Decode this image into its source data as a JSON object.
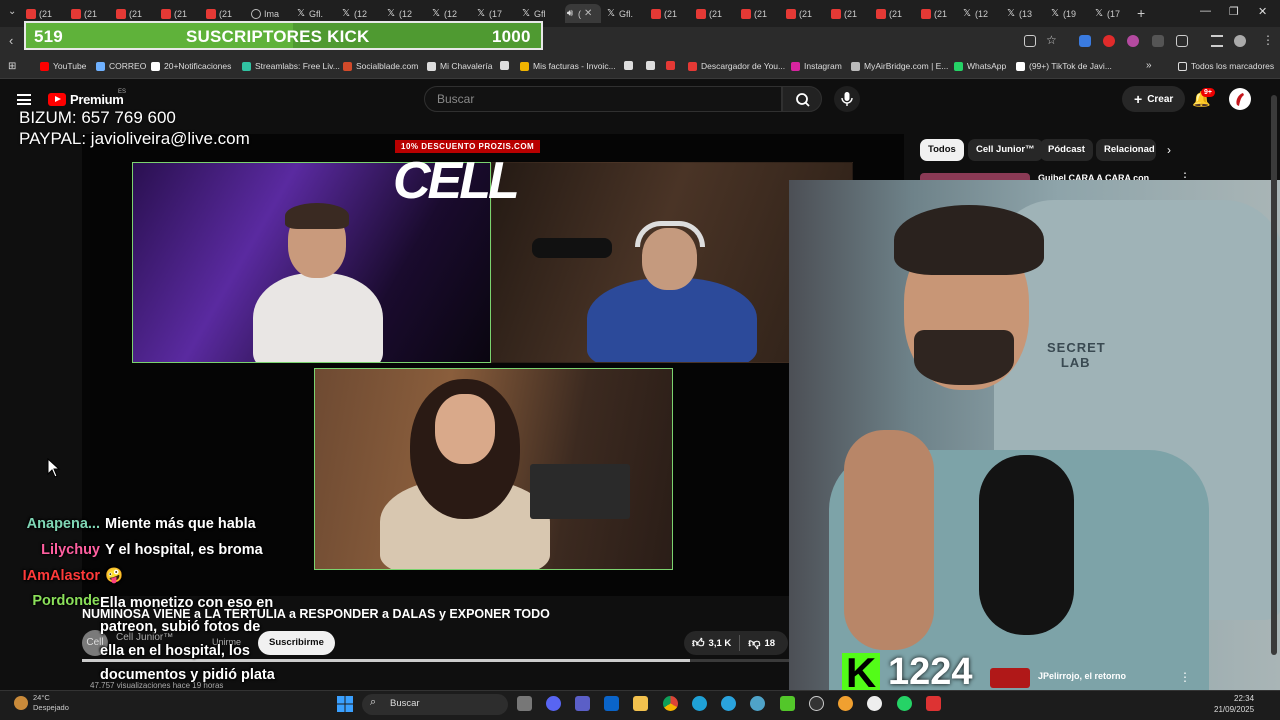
{
  "browser": {
    "tabs": [
      {
        "label": "(21",
        "icon": "youtube-icon"
      },
      {
        "label": "(21",
        "icon": "youtube-icon"
      },
      {
        "label": "(21",
        "icon": "youtube-icon"
      },
      {
        "label": "(21",
        "icon": "youtube-icon"
      },
      {
        "label": "(21",
        "icon": "youtube-icon"
      },
      {
        "label": "Ima",
        "icon": "globe-icon"
      },
      {
        "label": "Gfl.",
        "icon": "x-icon"
      },
      {
        "label": "(12",
        "icon": "x-icon"
      },
      {
        "label": "(12",
        "icon": "x-icon"
      },
      {
        "label": "(12",
        "icon": "x-icon"
      },
      {
        "label": "(17",
        "icon": "x-icon"
      },
      {
        "label": "Gfl",
        "icon": "x-icon"
      },
      {
        "label": "(",
        "icon": "audio-icon"
      },
      {
        "label": "Gfl.",
        "icon": "x-icon"
      },
      {
        "label": "(21",
        "icon": "youtube-icon"
      },
      {
        "label": "(21",
        "icon": "youtube-icon"
      },
      {
        "label": "(21",
        "icon": "youtube-icon"
      },
      {
        "label": "(21",
        "icon": "youtube-icon"
      },
      {
        "label": "(21",
        "icon": "youtube-icon"
      },
      {
        "label": "(21",
        "icon": "youtube-icon"
      },
      {
        "label": "(21",
        "icon": "youtube-icon"
      },
      {
        "label": "(12",
        "icon": "x-icon"
      },
      {
        "label": "(13",
        "icon": "x-icon"
      },
      {
        "label": "(19",
        "icon": "x-icon"
      },
      {
        "label": "(17",
        "icon": "x-icon"
      }
    ],
    "bookmarks": [
      {
        "label": "YouTube",
        "color": "#ff0000"
      },
      {
        "label": "CORREO",
        "color": "#6fb1ff"
      },
      {
        "label": "20+Notificaciones",
        "color": "#ffffff"
      },
      {
        "label": "Streamlabs: Free Liv...",
        "color": "#31c3a2"
      },
      {
        "label": "Socialblade.com",
        "color": "#d24a2a"
      },
      {
        "label": "Mi Chavalería",
        "color": "#dddddd"
      },
      {
        "label": "",
        "color": "#dddddd"
      },
      {
        "label": "Mis facturas - Invoic...",
        "color": "#f0b400"
      },
      {
        "label": "",
        "color": "#dddddd"
      },
      {
        "label": "",
        "color": "#dddddd"
      },
      {
        "label": "",
        "color": "#e53935"
      },
      {
        "label": "Descargador de You...",
        "color": "#e53935"
      },
      {
        "label": "Instagram",
        "color": "#d6249f"
      },
      {
        "label": "MyAirBridge.com | E...",
        "color": "#bbbbbb"
      },
      {
        "label": "WhatsApp",
        "color": "#25d366"
      },
      {
        "label": "(99+) TikTok de Javi...",
        "color": "#ffffff"
      }
    ],
    "all_bookmarks": "Todos los marcadores"
  },
  "kick_goal": {
    "current": "519",
    "title": "SUSCRIPTORES KICK",
    "goal": "1000",
    "progress_fraction": 0.519
  },
  "donation": {
    "bizum": "BIZUM: 657 769 600",
    "paypal": "PAYPAL: javioliveira@live.com"
  },
  "youtube": {
    "logo_text": "Premium",
    "region": "ES",
    "search_placeholder": "Buscar",
    "create_label": "Crear",
    "notifications_badge": "9+",
    "chips": [
      "Todos",
      "Cell Junior™",
      "Pódcast",
      "Relacionad"
    ],
    "recommended": [
      {
        "title": "Guibel CARA A CARA con"
      },
      {
        "title": "JPelirrojo, el retorno"
      }
    ]
  },
  "video": {
    "promo": "10% DESCUENTO PROZIS.COM",
    "logo": "CELL",
    "title": "NUMINOSA VIENE a LA TERTULIA a RESPONDER a DALAS y EXPONER TODO",
    "channel": "Cell Junior™",
    "join_label": "Unirme",
    "subscribe_label": "Suscribirme",
    "likes": "3,1 K",
    "dislikes": "18",
    "views": "47.757 visualizaciones  hace 19 horas",
    "progress_fraction": 0.86
  },
  "kick_count": {
    "logo": "K",
    "value": "1224"
  },
  "chat": [
    {
      "user": "Anapena...",
      "color": "#7fd6b5",
      "message": "Miente más que habla"
    },
    {
      "user": "Lilychuy",
      "color": "#ff5fa0",
      "message": "Y el hospital, es broma"
    },
    {
      "user": "IAmAlastor",
      "color": "#ff3a3a",
      "message": "🤪"
    },
    {
      "user": "Pordonde",
      "color": "#8be05a",
      "message": "Ella monetizo con eso en patreon, subió fotos de ella en el hospital, los documentos y pidió plata"
    }
  ],
  "taskbar": {
    "weather_temp": "24°C",
    "weather_desc": "Despejado",
    "search_placeholder": "Buscar",
    "time": "22:34",
    "date": "21/09/2025"
  }
}
